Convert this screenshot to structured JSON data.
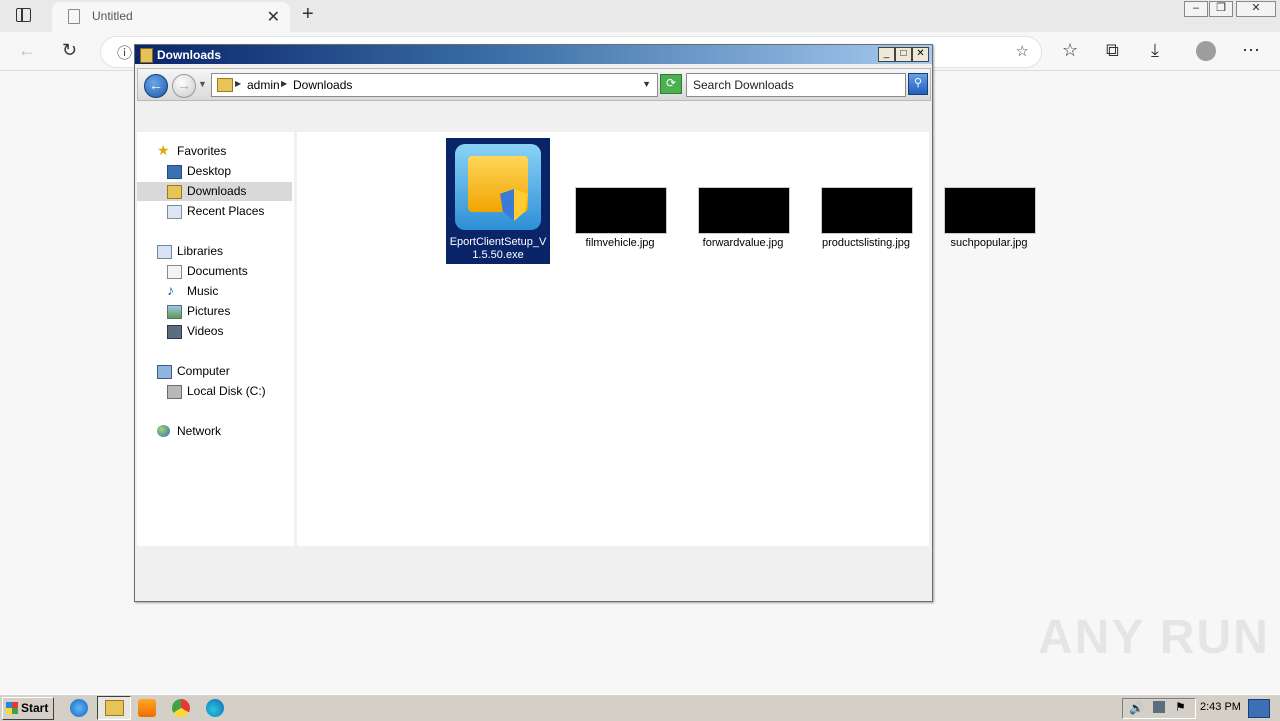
{
  "browser": {
    "tab_title": "Untitled",
    "new_tab_glyph": "+",
    "close_glyph": "✕",
    "address_info_glyph": "ⓘ",
    "toolbar_icons": [
      "add-favorite-icon",
      "favorites-icon",
      "collections-icon",
      "downloads-icon",
      "profile-icon",
      "more-icon"
    ]
  },
  "window": {
    "title": "Downloads",
    "min_glyph": "_",
    "max_glyph": "□",
    "close_glyph": "✕"
  },
  "breadcrumb": {
    "segments": [
      "admin",
      "Downloads"
    ]
  },
  "search": {
    "placeholder": "Search Downloads"
  },
  "nav_pane": {
    "favorites": {
      "label": "Favorites",
      "items": [
        "Desktop",
        "Downloads",
        "Recent Places"
      ]
    },
    "libraries": {
      "label": "Libraries",
      "items": [
        "Documents",
        "Music",
        "Pictures",
        "Videos"
      ]
    },
    "computer": {
      "label": "Computer",
      "items": [
        "Local Disk (C:)"
      ]
    },
    "network": {
      "label": "Network"
    }
  },
  "files": [
    {
      "name": "EportClientSetup_V1.5.50.exe",
      "line1": "EportClientSetup_V",
      "line2": "1.5.50.exe",
      "selected": true
    },
    {
      "name": "filmvehicle.jpg"
    },
    {
      "name": "forwardvalue.jpg"
    },
    {
      "name": "productslisting.jpg"
    },
    {
      "name": "suchpopular.jpg"
    }
  ],
  "taskbar": {
    "start_label": "Start",
    "clock": "2:43 PM"
  },
  "watermark": "ANY RUN",
  "colors": {
    "selection": "#0a246a",
    "titlebar_start": "#0a246a",
    "titlebar_end": "#a6caf0"
  }
}
